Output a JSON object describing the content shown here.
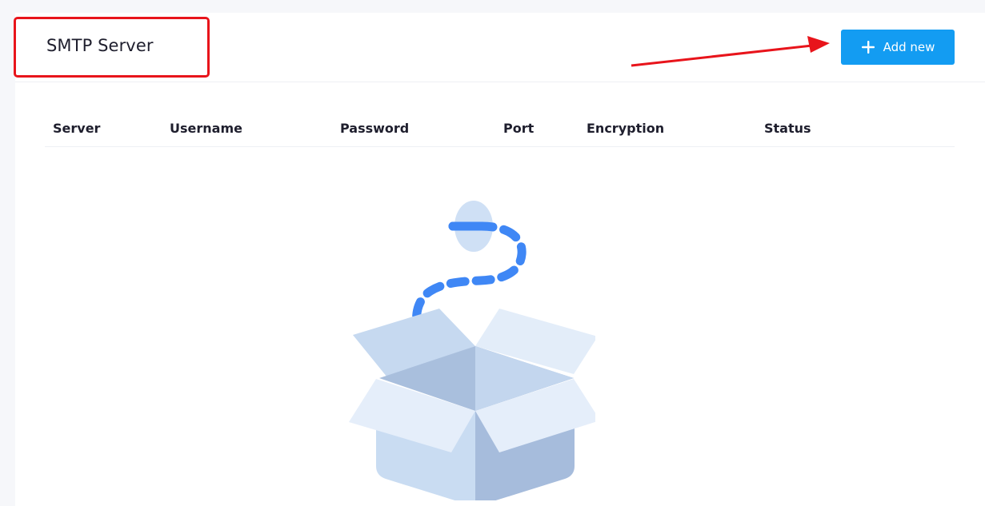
{
  "header": {
    "title": "SMTP Server",
    "add_button_label": "Add new"
  },
  "table": {
    "columns": [
      "Server",
      "Username",
      "Password",
      "Port",
      "Encryption",
      "Status"
    ]
  },
  "colors": {
    "accent": "#139cf2",
    "annotation": "#e8141b"
  },
  "icons": {
    "add": "plus-icon",
    "empty": "empty-box-illustration"
  }
}
